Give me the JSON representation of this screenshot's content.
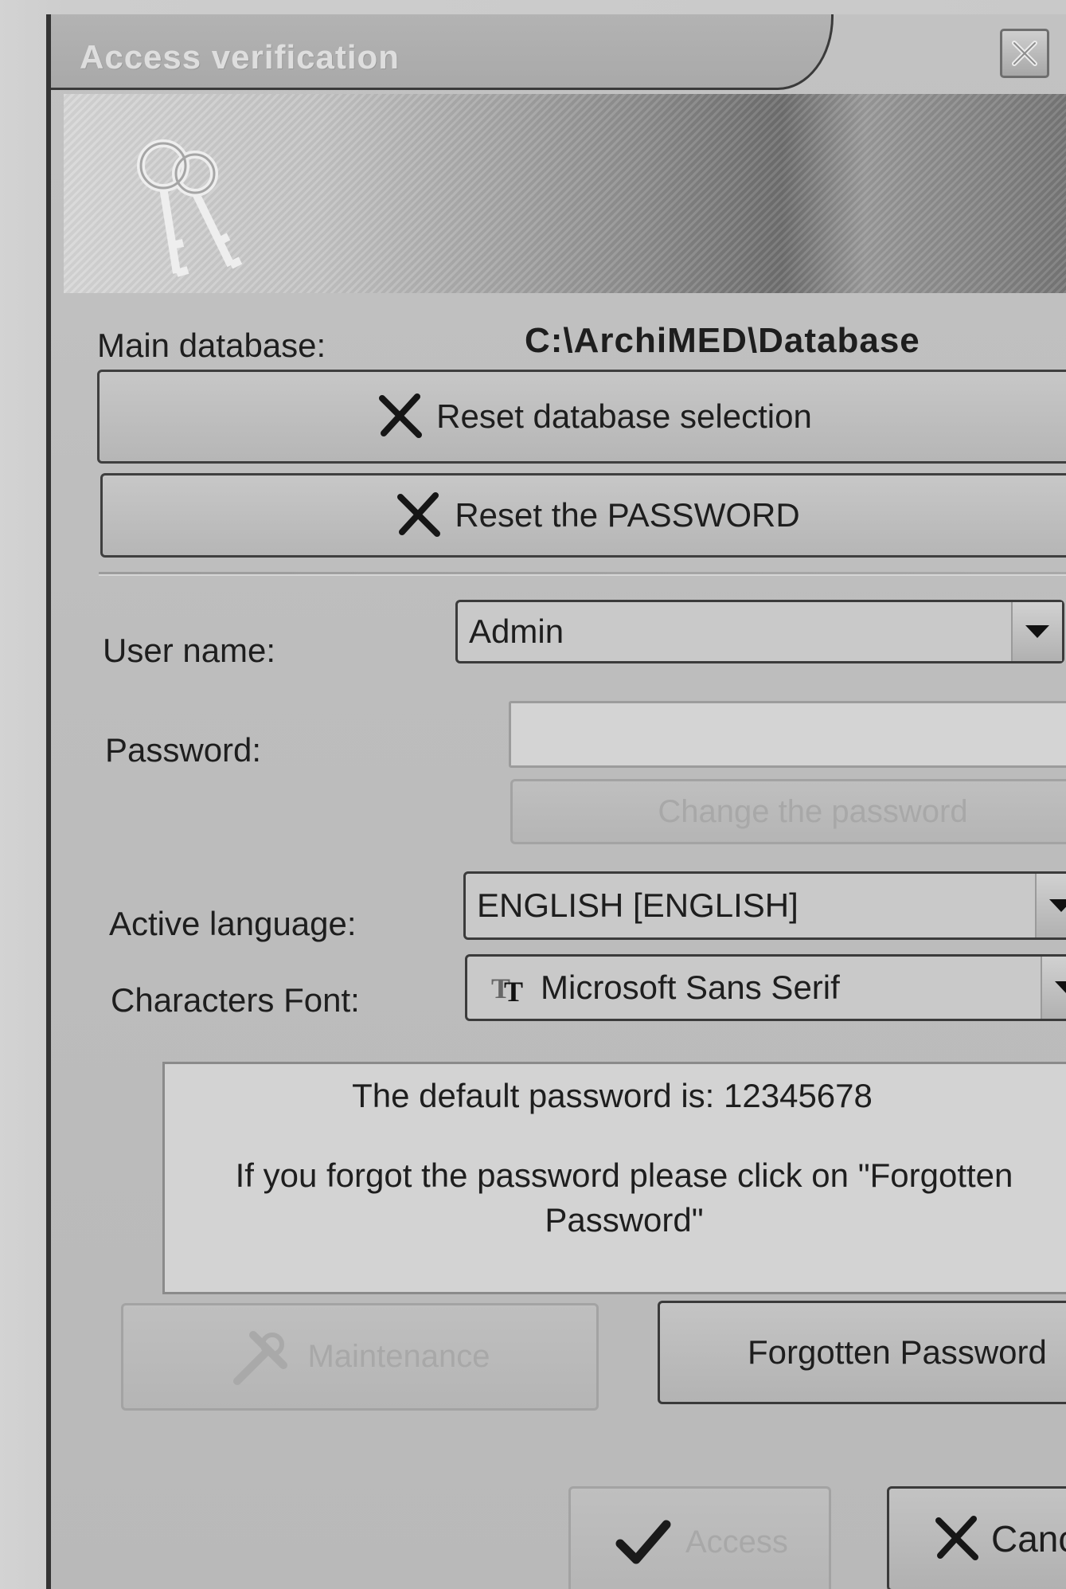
{
  "window": {
    "title": "Access verification"
  },
  "database": {
    "label": "Main database:",
    "path": "C:\\ArchiMED\\Database"
  },
  "buttons": {
    "reset_database": "Reset database selection",
    "reset_password": "Reset the PASSWORD",
    "change_password": "Change the password",
    "maintenance": "Maintenance",
    "forgotten_password": "Forgotten Password",
    "access": "Access",
    "cancel": "Cancel"
  },
  "form": {
    "username_label": "User name:",
    "username_value": "Admin",
    "password_label": "Password:",
    "password_value": "",
    "language_label": "Active language:",
    "language_value": "ENGLISH [ENGLISH]",
    "font_label": "Characters Font:",
    "font_value": "Microsoft Sans Serif"
  },
  "info": {
    "line1": "The default password is: 12345678",
    "line2": "If you forgot the password please click on \"Forgotten Password\""
  },
  "icons": {
    "close": "close-icon",
    "keys": "keys-icon",
    "reset": "x-cross-icon",
    "dropdown": "chevron-down-icon",
    "font_type": "truetype-font-icon",
    "maintenance": "wrench-tools-icon",
    "access": "checkmark-icon",
    "cancel": "x-cross-icon"
  }
}
